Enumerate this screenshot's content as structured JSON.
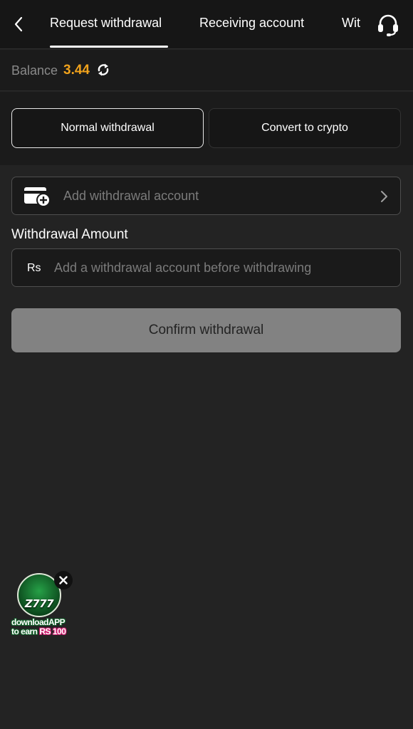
{
  "header": {
    "tabs": [
      {
        "label": "Request withdrawal",
        "active": true
      },
      {
        "label": "Receiving account",
        "active": false
      },
      {
        "label": "Wit",
        "active": false
      }
    ],
    "back_icon": "chevron-left-icon",
    "support_icon": "headset-icon"
  },
  "balance": {
    "label": "Balance",
    "value": "3.44",
    "refresh_icon": "refresh-icon",
    "value_color": "#f0a21c"
  },
  "modes": {
    "normal_label": "Normal withdrawal",
    "crypto_label": "Convert to crypto",
    "selected": "Normal withdrawal"
  },
  "account": {
    "placeholder": "Add withdrawal account",
    "icon": "wallet-add-icon",
    "chevron_icon": "chevron-right-icon"
  },
  "amount": {
    "label": "Withdrawal Amount",
    "currency": "Rs",
    "placeholder": "Add a withdrawal account before withdrawing"
  },
  "confirm": {
    "label": "Confirm withdrawal"
  },
  "promo": {
    "brand": "Z777",
    "line1": "downloadAPP",
    "line2_prefix": "to earn",
    "line2_amount": "RS 100",
    "close_icon": "close-icon"
  }
}
